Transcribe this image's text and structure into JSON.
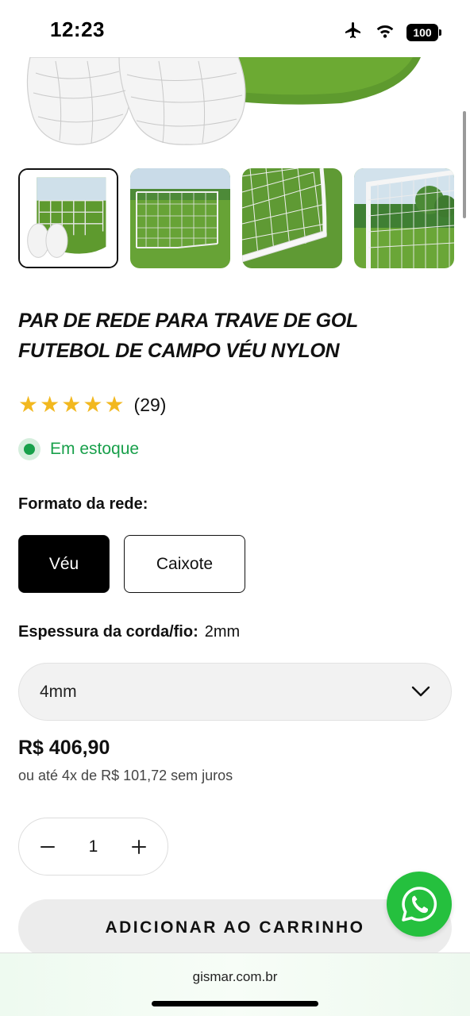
{
  "status_bar": {
    "time": "12:23",
    "battery": "100",
    "icons": [
      "airplane-icon",
      "wifi-icon",
      "battery-icon"
    ]
  },
  "gallery": {
    "thumbnails": [
      {
        "name": "thumb-1",
        "selected": true
      },
      {
        "name": "thumb-2",
        "selected": false
      },
      {
        "name": "thumb-3",
        "selected": false
      },
      {
        "name": "thumb-4",
        "selected": false
      }
    ]
  },
  "product": {
    "title_line1": "PAR DE REDE PARA TRAVE DE GOL",
    "title_line2": "FUTEBOL DE CAMPO VÉU NYLON",
    "rating_stars": 5,
    "rating_count": "(29)",
    "stock": "Em estoque"
  },
  "format": {
    "label": "Formato da rede:",
    "options": [
      "Véu",
      "Caixote"
    ],
    "selected": "Véu"
  },
  "thickness": {
    "label": "Espessura da corda/fio:",
    "current": "2mm",
    "select_value": "4mm"
  },
  "price": {
    "value": "R$ 406,90",
    "installments": "ou até 4x de R$ 101,72 sem juros"
  },
  "quantity": {
    "value": "1"
  },
  "cart_button": "ADICIONAR AO CARRINHO",
  "browser": {
    "url": "gismar.com.br"
  },
  "colors": {
    "star": "#f2b81f",
    "stock_green": "#19a04b",
    "whatsapp_green": "#25c03e",
    "selected_bg": "#000000"
  }
}
